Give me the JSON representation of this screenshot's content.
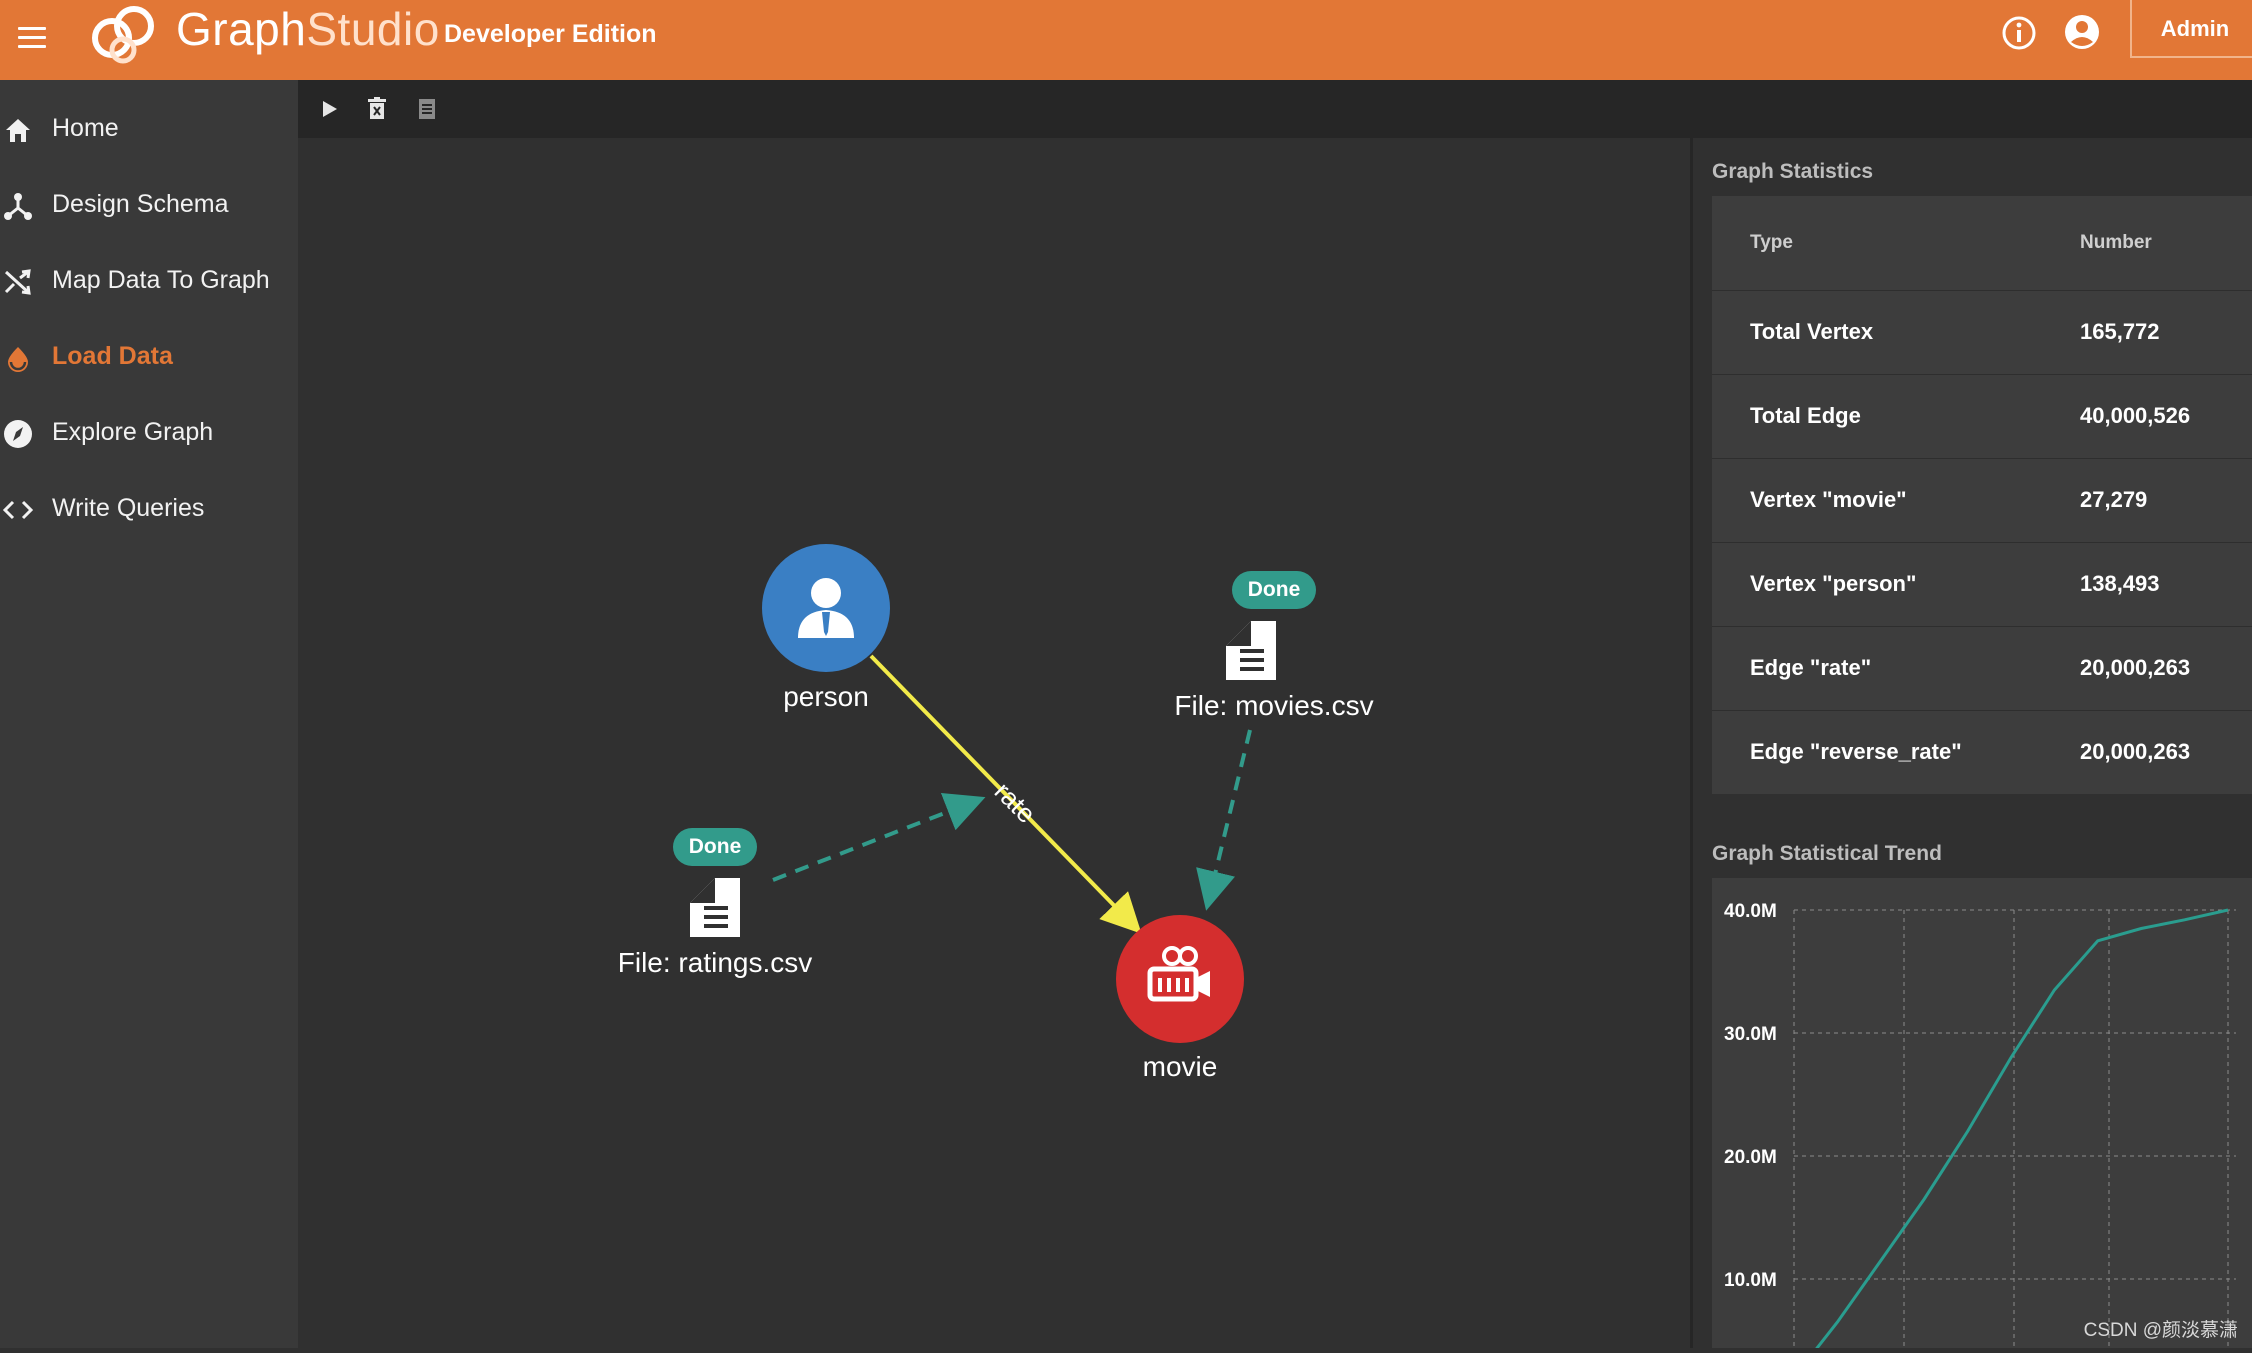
{
  "header": {
    "brand_part1": "Graph",
    "brand_part2": "Studio",
    "edition": "Developer Edition",
    "admin_label": "Admin",
    "bar_color": "#e27736"
  },
  "sidebar": {
    "items": [
      {
        "label": "Home",
        "icon": "home-icon"
      },
      {
        "label": "Design Schema",
        "icon": "schema-icon"
      },
      {
        "label": "Map Data To Graph",
        "icon": "shuffle-icon"
      },
      {
        "label": "Load Data",
        "icon": "drop-icon",
        "active": true
      },
      {
        "label": "Explore Graph",
        "icon": "compass-icon"
      },
      {
        "label": "Write Queries",
        "icon": "code-icon"
      }
    ],
    "active_color": "#e27736"
  },
  "toolbar": {
    "icons": [
      "play-icon",
      "delete-icon",
      "log-icon"
    ]
  },
  "graph": {
    "nodes": {
      "person": {
        "label": "person",
        "color": "#3a7fc4"
      },
      "movie": {
        "label": "movie",
        "color": "#d42e2e"
      }
    },
    "edge_label": "rate",
    "edge_color": "#f2ea4a",
    "files": {
      "movies": {
        "label": "File: movies.csv",
        "status": "Done"
      },
      "ratings": {
        "label": "File: ratings.csv",
        "status": "Done"
      }
    },
    "mapping_color": "#329b8b"
  },
  "stats": {
    "title": "Graph Statistics",
    "col_type": "Type",
    "col_number": "Number",
    "rows": [
      {
        "type": "Total Vertex",
        "number": "165,772"
      },
      {
        "type": "Total Edge",
        "number": "40,000,526"
      },
      {
        "type": "Vertex \"movie\"",
        "number": "27,279"
      },
      {
        "type": "Vertex \"person\"",
        "number": "138,493"
      },
      {
        "type": "Edge \"rate\"",
        "number": "20,000,263"
      },
      {
        "type": "Edge \"reverse_rate\"",
        "number": "20,000,263"
      }
    ]
  },
  "trend": {
    "title": "Graph Statistical Trend"
  },
  "chart_data": {
    "type": "line",
    "title": "Graph Statistical Trend",
    "ylim": [
      0,
      40000000
    ],
    "yticks": [
      "40.0M",
      "30.0M",
      "20.0M",
      "10.0M"
    ],
    "grid": true,
    "color": "#2a9d8f",
    "x": [
      0,
      1,
      2,
      3,
      4,
      5,
      6,
      7,
      8,
      9,
      10
    ],
    "series": [
      {
        "values": [
          2000000,
          6500000,
          11500000,
          16500000,
          22000000,
          28000000,
          33500000,
          37500000,
          38500000,
          39200000,
          40000526
        ]
      }
    ]
  },
  "watermark": "CSDN @颜淡慕潇"
}
